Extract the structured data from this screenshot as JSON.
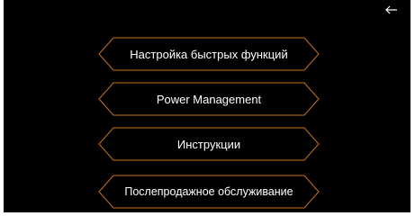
{
  "header": {
    "back_icon": "arrow-left-icon"
  },
  "menu": {
    "items": [
      {
        "label": "Настройка быстрых функций"
      },
      {
        "label": "Power Management"
      },
      {
        "label": "Инструкции"
      },
      {
        "label": "Послепродажное обслуживание"
      }
    ]
  },
  "colors": {
    "background": "#000000",
    "outline": "#c8711f",
    "text": "#ffffff"
  }
}
